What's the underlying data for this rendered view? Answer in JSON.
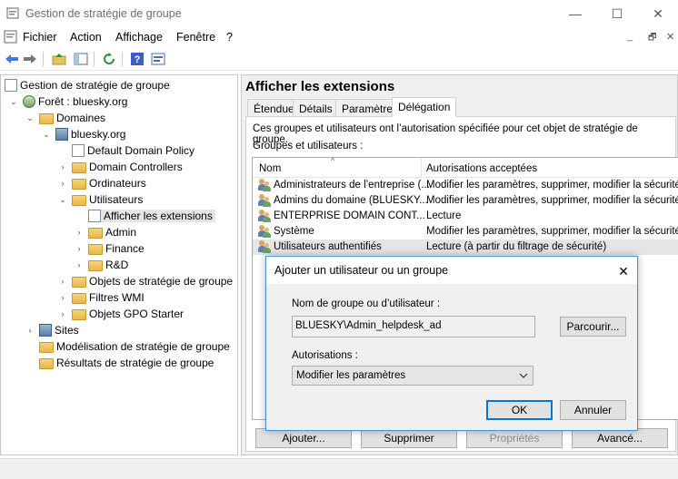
{
  "window": {
    "title": "Gestion de stratégie de groupe",
    "minimize": "—",
    "maximize": "☐",
    "close": "✕"
  },
  "menu": [
    "Fichier",
    "Action",
    "Affichage",
    "Fenêtre",
    "?"
  ],
  "mdi": {
    "minimize": "_",
    "restore": "🗗",
    "close": "✕"
  },
  "tree": {
    "items": [
      {
        "label": "Gestion de stratégie de groupe"
      },
      {
        "label": "Forêt : bluesky.org"
      },
      {
        "label": "Domaines"
      },
      {
        "label": "bluesky.org"
      },
      {
        "label": "Default Domain Policy"
      },
      {
        "label": "Domain Controllers"
      },
      {
        "label": "Ordinateurs"
      },
      {
        "label": "Utilisateurs"
      },
      {
        "label": "Afficher les extensions"
      },
      {
        "label": "Admin"
      },
      {
        "label": "Finance"
      },
      {
        "label": "R&D"
      },
      {
        "label": "Objets de stratégie de groupe"
      },
      {
        "label": "Filtres WMI"
      },
      {
        "label": "Objets GPO Starter"
      },
      {
        "label": "Sites"
      },
      {
        "label": "Modélisation de stratégie de groupe"
      },
      {
        "label": "Résultats de stratégie de groupe"
      }
    ]
  },
  "panel": {
    "title": "Afficher les extensions",
    "tabs": [
      "Étendue",
      "Détails",
      "Paramètres",
      "Délégation"
    ],
    "description": "Ces groupes et utilisateurs ont l’autorisation spécifiée pour cet objet de stratégie de groupe.",
    "list_label": "Groupes et utilisateurs :",
    "columns": [
      "Nom",
      "Autorisations acceptées"
    ],
    "rows": [
      {
        "name": "Administrateurs de l’entreprise (...",
        "perm": "Modifier les paramètres, supprimer, modifier la sécurité"
      },
      {
        "name": "Admins du domaine (BLUESKY...",
        "perm": "Modifier les paramètres, supprimer, modifier la sécurité"
      },
      {
        "name": "ENTERPRISE DOMAIN CONT...",
        "perm": "Lecture"
      },
      {
        "name": "Système",
        "perm": "Modifier les paramètres, supprimer, modifier la sécurité"
      },
      {
        "name": "Utilisateurs authentifiés",
        "perm": "Lecture (à partir du filtrage de sécurité)"
      }
    ],
    "buttons": {
      "add": "Ajouter...",
      "remove": "Supprimer",
      "properties": "Propriétés",
      "advanced": "Avancé..."
    }
  },
  "dialog": {
    "title": "Ajouter un utilisateur ou un groupe",
    "close": "✕",
    "name_label": "Nom de groupe ou d’utilisateur :",
    "name_value": "BLUESKY\\Admin_helpdesk_ad",
    "browse": "Parcourir...",
    "perm_label": "Autorisations :",
    "perm_value": "Modifier les paramètres",
    "ok": "OK",
    "cancel": "Annuler"
  }
}
